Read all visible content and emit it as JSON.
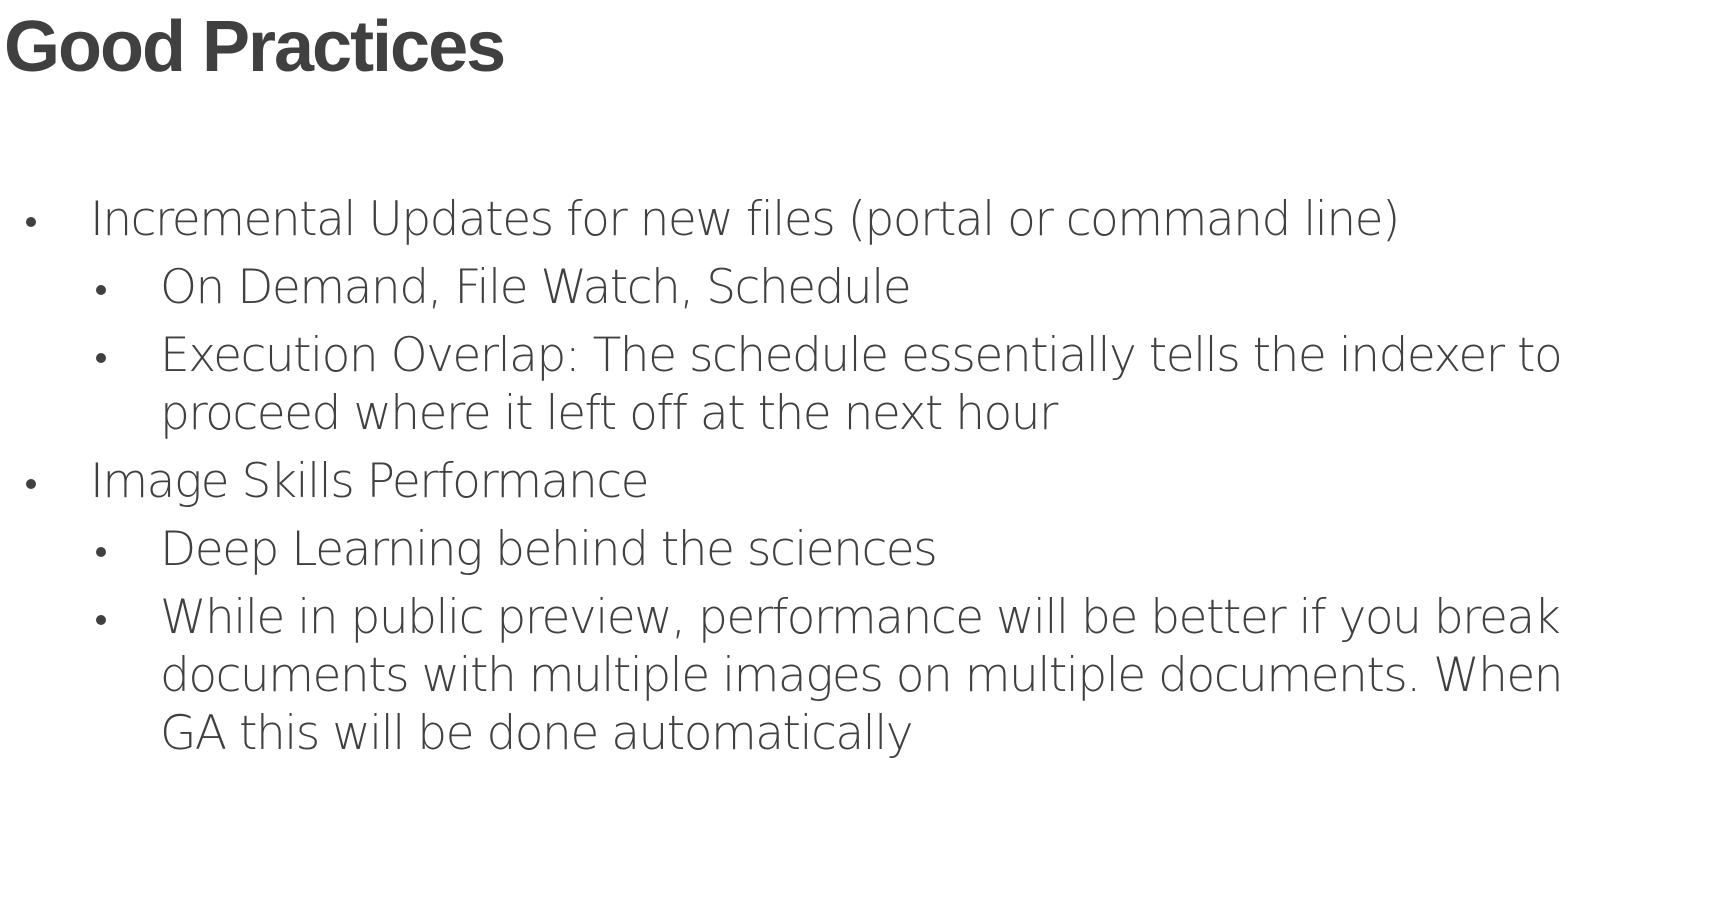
{
  "title": "Good Practices",
  "bullets": [
    {
      "text": "Incremental Updates for new files (portal or command line)"
    },
    {
      "text": "On Demand, File Watch, Schedule"
    },
    {
      "text": "Execution Overlap: The schedule essentially tells the indexer to proceed where it left off at the next hour"
    },
    {
      "text": "Image Skills Performance"
    },
    {
      "text": "Deep Learning behind the sciences"
    },
    {
      "text": "While in public preview, performance will be better if you break documents with multiple images on multiple documents. When GA this will be done automatically"
    }
  ],
  "colors": {
    "text": "#404040",
    "background": "#ffffff"
  }
}
